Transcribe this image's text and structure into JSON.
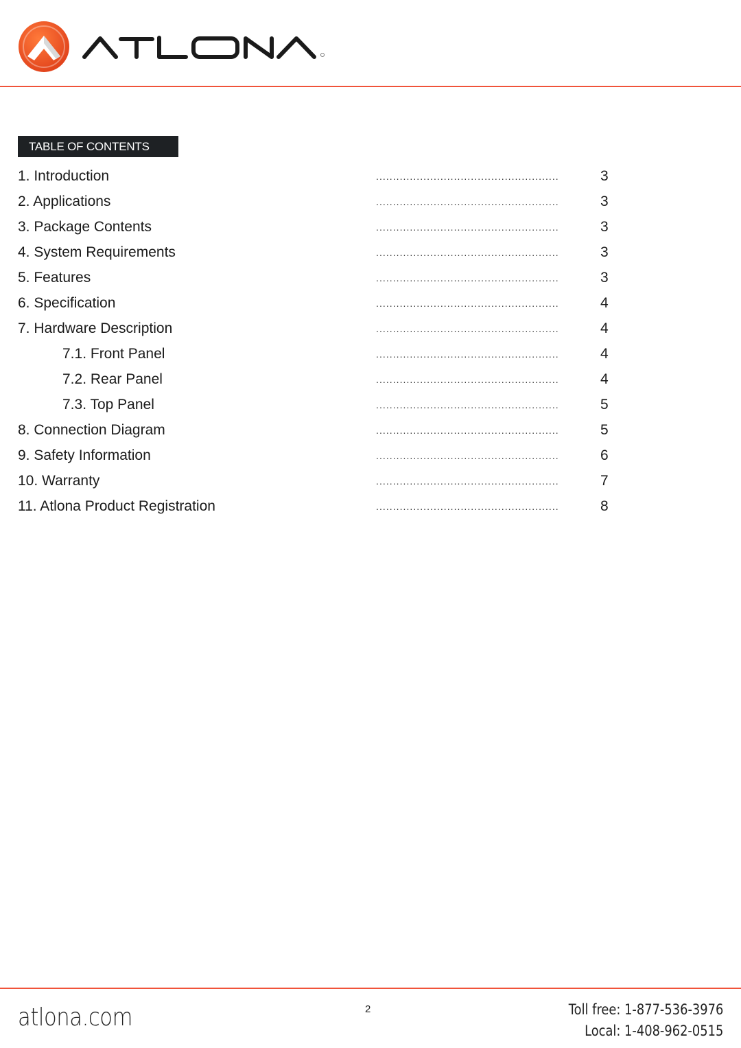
{
  "brand": {
    "name": "ATLONA",
    "registered_mark": "®",
    "accent_color": "#f0533a"
  },
  "toc": {
    "heading": "TABLE OF CONTENTS",
    "leader": "......................................................",
    "entries": [
      {
        "title": "1. Introduction",
        "page": "3",
        "level": 1
      },
      {
        "title": "2. Applications",
        "page": "3",
        "level": 1
      },
      {
        "title": "3. Package Contents",
        "page": "3",
        "level": 1
      },
      {
        "title": "4. System Requirements",
        "page": "3",
        "level": 1
      },
      {
        "title": "5. Features",
        "page": "3",
        "level": 1
      },
      {
        "title": "6. Specification",
        "page": "4",
        "level": 1
      },
      {
        "title": "7. Hardware Description",
        "page": "4",
        "level": 1
      },
      {
        "title": "7.1. Front Panel",
        "page": "4",
        "level": 2
      },
      {
        "title": "7.2. Rear Panel",
        "page": "4",
        "level": 2
      },
      {
        "title": "7.3. Top Panel",
        "page": "5",
        "level": 2
      },
      {
        "title": "8. Connection Diagram",
        "page": "5",
        "level": 1
      },
      {
        "title": "9. Safety Information",
        "page": "6",
        "level": 1
      },
      {
        "title": "10. Warranty",
        "page": "7",
        "level": 1
      },
      {
        "title": "11. Atlona Product Registration",
        "page": "8",
        "level": 1
      }
    ]
  },
  "footer": {
    "website": "atlona.com",
    "page_number": "2",
    "toll_free": "Toll free: 1-877-536-3976",
    "local": "Local: 1-408-962-0515"
  }
}
